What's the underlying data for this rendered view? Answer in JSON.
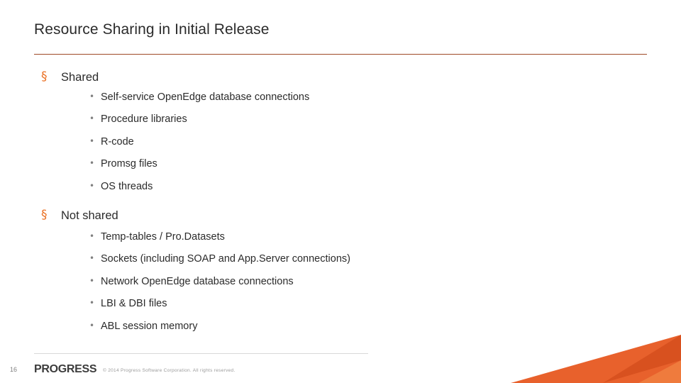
{
  "slide": {
    "title": "Resource Sharing in Initial Release",
    "page_number": "16",
    "logo": "PROGRESS",
    "copyright": "© 2014 Progress Software Corporation. All rights reserved.",
    "accent_color": "#ea7125",
    "rule_color": "#9e4a26",
    "groups": [
      {
        "heading": "Shared",
        "items": [
          "Self-service OpenEdge database connections",
          "Procedure libraries",
          "R-code",
          "Promsg files",
          "OS threads"
        ]
      },
      {
        "heading": "Not shared",
        "items": [
          "Temp-tables / Pro.Datasets",
          "Sockets (including SOAP and App.Server connections)",
          "Network OpenEdge database connections",
          "LBI & DBI files",
          "ABL session memory"
        ]
      }
    ],
    "bullets": {
      "level1_glyph": "§",
      "level2_glyph": "•"
    }
  }
}
